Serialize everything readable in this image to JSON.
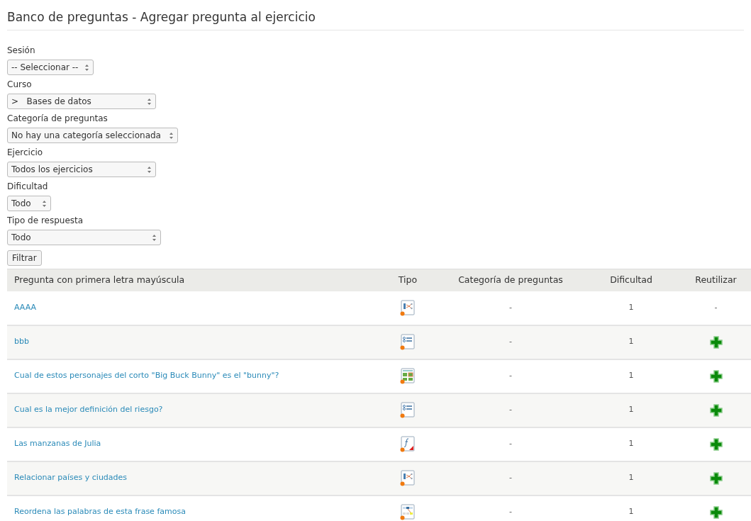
{
  "title": "Banco de preguntas - Agregar pregunta al ejercicio",
  "filters": [
    {
      "label": "Sesión",
      "value": "-- Seleccionar --"
    },
    {
      "label": "Curso",
      "value": ">   Bases de datos"
    },
    {
      "label": "Categoría de preguntas",
      "value": "No hay una categoría seleccionada"
    },
    {
      "label": "Ejercicio",
      "value": "Todos los ejercicios"
    },
    {
      "label": "Dificultad",
      "value": "Todo"
    },
    {
      "label": "Tipo de respuesta",
      "value": "Todo"
    }
  ],
  "filter_button": "Filtrar",
  "table": {
    "columns": [
      "Pregunta con primera letra mayúscula",
      "Tipo",
      "Categoría de preguntas",
      "Dificultad",
      "Reutilizar"
    ],
    "rows": [
      {
        "question": "AAAA",
        "kind": "matching",
        "category": "-",
        "difficulty": "1",
        "reuse": {
          "kind": "text",
          "text": "-"
        }
      },
      {
        "question": "bbb",
        "kind": "choice",
        "category": "-",
        "difficulty": "1",
        "reuse": {
          "kind": "add"
        }
      },
      {
        "question": "Cual de estos personajes del corto \"Big Buck Bunny\" es el \"bunny\"?",
        "kind": "hotspot",
        "category": "-",
        "difficulty": "1",
        "reuse": {
          "kind": "add"
        }
      },
      {
        "question": "Cual es la mejor definición del riesgo?",
        "kind": "choice",
        "category": "-",
        "difficulty": "1",
        "reuse": {
          "kind": "add"
        }
      },
      {
        "question": "Las manzanas de Julia",
        "kind": "formula",
        "category": "-",
        "difficulty": "1",
        "reuse": {
          "kind": "add"
        }
      },
      {
        "question": "Relacionar países y ciudades",
        "kind": "matching",
        "category": "-",
        "difficulty": "1",
        "reuse": {
          "kind": "add"
        }
      },
      {
        "question": "Reordena las palabras de esta frase famosa",
        "kind": "ordering",
        "category": "-",
        "difficulty": "1",
        "reuse": {
          "kind": "add"
        }
      }
    ]
  }
}
